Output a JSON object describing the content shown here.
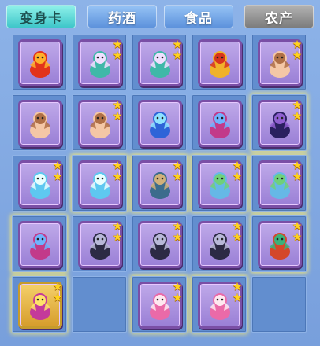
{
  "tabs": [
    {
      "label": "变身卡",
      "state": "active",
      "color": "#4ccfd0"
    },
    {
      "label": "药酒",
      "state": "normal",
      "color": "#6fa2e2"
    },
    {
      "label": "食品",
      "state": "normal",
      "color": "#6fa2e2"
    },
    {
      "label": "农产",
      "state": "disabled",
      "color": "#8c8c8c"
    }
  ],
  "inventory": [
    {
      "icon": "fire-monster-icon",
      "stars": 0,
      "glow": false,
      "frame": "purple"
    },
    {
      "icon": "fairy-maiden-icon",
      "stars": 2,
      "glow": false,
      "frame": "purple"
    },
    {
      "icon": "fairy-maiden-icon",
      "stars": 2,
      "glow": false,
      "frame": "purple"
    },
    {
      "icon": "lion-dance-icon",
      "stars": 0,
      "glow": false,
      "frame": "purple"
    },
    {
      "icon": "piglet-icon",
      "stars": 2,
      "glow": false,
      "frame": "purple"
    },
    {
      "icon": "piglet-icon",
      "stars": 0,
      "glow": false,
      "frame": "purple"
    },
    {
      "icon": "piglet-icon",
      "stars": 2,
      "glow": false,
      "frame": "purple"
    },
    {
      "icon": "blue-sorceress-icon",
      "stars": 0,
      "glow": false,
      "frame": "purple"
    },
    {
      "icon": "phoenix-bird-icon",
      "stars": 0,
      "glow": false,
      "frame": "purple"
    },
    {
      "icon": "dark-horse-icon",
      "stars": 2,
      "glow": true,
      "frame": "purple"
    },
    {
      "icon": "ice-dragon-icon",
      "stars": 2,
      "glow": false,
      "frame": "purple"
    },
    {
      "icon": "ice-dragon-icon",
      "stars": 2,
      "glow": true,
      "frame": "purple"
    },
    {
      "icon": "warrior-woman-icon",
      "stars": 2,
      "glow": true,
      "frame": "purple"
    },
    {
      "icon": "winged-beast-icon",
      "stars": 2,
      "glow": true,
      "frame": "purple"
    },
    {
      "icon": "winged-beast-icon",
      "stars": 2,
      "glow": true,
      "frame": "purple"
    },
    {
      "icon": "phoenix-bird-icon",
      "stars": 0,
      "glow": true,
      "frame": "purple"
    },
    {
      "icon": "dark-swordsman-icon",
      "stars": 2,
      "glow": false,
      "frame": "purple"
    },
    {
      "icon": "dark-swordsman-icon",
      "stars": 2,
      "glow": false,
      "frame": "purple"
    },
    {
      "icon": "dark-swordsman-icon",
      "stars": 2,
      "glow": false,
      "frame": "purple"
    },
    {
      "icon": "fire-dragon-icon",
      "stars": 2,
      "glow": true,
      "frame": "purple"
    },
    {
      "icon": "gold-princess-icon",
      "stars": 2,
      "glow": true,
      "frame": "gold"
    },
    {
      "icon": "",
      "stars": 0,
      "glow": false,
      "frame": "empty"
    },
    {
      "icon": "pink-girl-icon",
      "stars": 2,
      "glow": true,
      "frame": "purple"
    },
    {
      "icon": "pink-girl-icon",
      "stars": 2,
      "glow": true,
      "frame": "purple"
    },
    {
      "icon": "",
      "stars": 0,
      "glow": false,
      "frame": "empty"
    }
  ]
}
